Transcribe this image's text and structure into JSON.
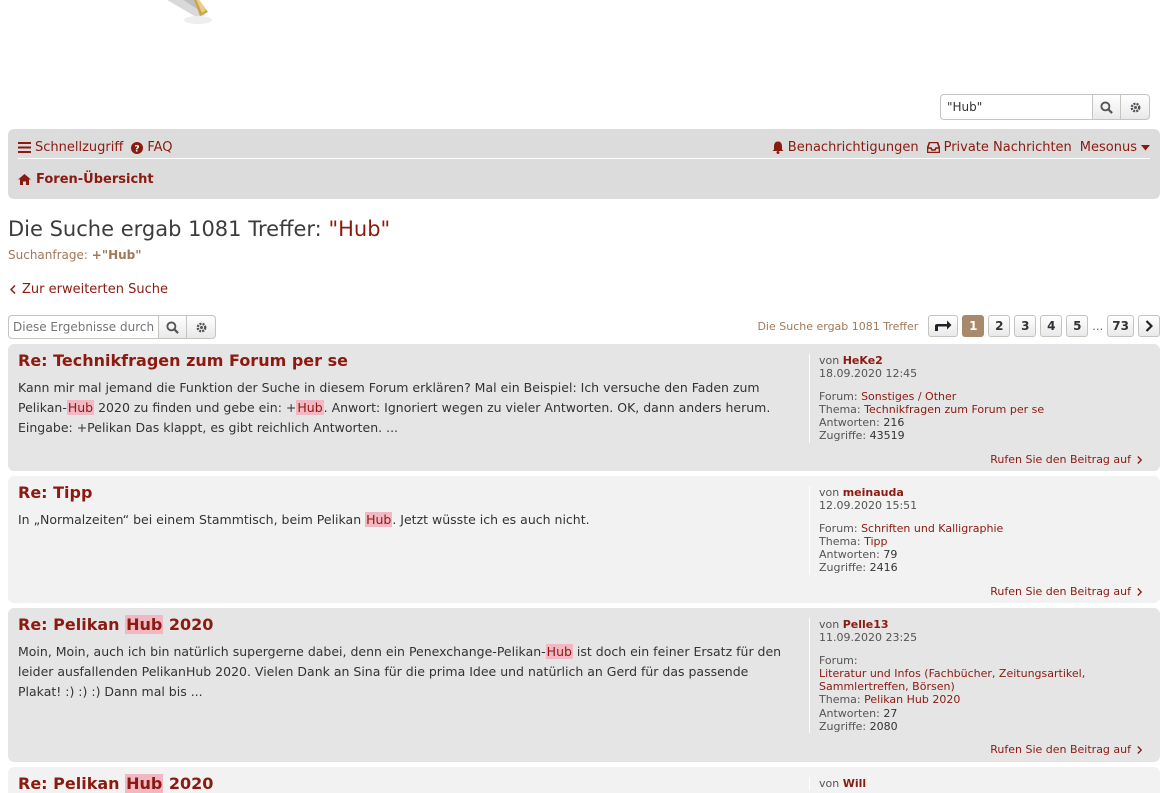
{
  "header": {
    "search_value": "\"Hub\""
  },
  "navbar": {
    "quicklinks": "Schnellzugriff",
    "faq": "FAQ",
    "notifications": "Benachrichtigungen",
    "private_messages": "Private Nachrichten",
    "username": "Mesonus",
    "breadcrumb": "Foren-Übersicht"
  },
  "search": {
    "title_prefix": "Die Suche ergab 1081 Treffer: ",
    "title_query": "\"Hub\"",
    "query_label": "Suchanfrage: ",
    "query_value": "+\"Hub\"",
    "advanced_link": "Zur erweiterten Suche",
    "filter_placeholder": "Diese Ergebnisse durchsuchen",
    "result_count": "Die Suche ergab 1081 Treffer"
  },
  "pagination": {
    "pages": [
      "1",
      "2",
      "3",
      "4",
      "5"
    ],
    "ellipsis": "…",
    "last": "73",
    "current": "1"
  },
  "labels": {
    "by": "von ",
    "forum": "Forum: ",
    "topic": "Thema: ",
    "replies": "Antworten: ",
    "views": "Zugriffe: ",
    "jump": "Rufen Sie den Beitrag auf"
  },
  "posts": [
    {
      "title": "Re: Technikfragen zum Forum per se",
      "body_parts": [
        "Kann mir mal jemand die Funktion der Suche in diesem Forum erklären? Mal ein Beispiel: Ich versuche den Faden zum Pelikan-",
        "Hub",
        " 2020 zu finden und gebe ein: +",
        "Hub",
        ". Anwort: Ignoriert wegen zu vieler Antworten. OK, dann anders herum. Eingabe: +Pelikan Das klappt, es gibt reichlich Antworten. ..."
      ],
      "author": "HeKe2",
      "date": "18.09.2020 12:45",
      "forum": "Sonstiges / Other",
      "topic": "Technikfragen zum Forum per se",
      "replies": "216",
      "views": "43519"
    },
    {
      "title": "Re: Tipp",
      "body_parts": [
        "In „Normalzeiten“ bei einem Stammtisch, beim Pelikan ",
        "Hub",
        ". Jetzt wüsste ich es auch nicht."
      ],
      "author": "meinauda",
      "date": "12.09.2020 15:51",
      "forum": "Schriften und Kalligraphie",
      "topic": "Tipp",
      "replies": "79",
      "views": "2416"
    },
    {
      "title_parts": [
        "Re: Pelikan ",
        "Hub",
        " 2020"
      ],
      "body_parts": [
        "Moin, Moin, auch ich bin natürlich supergerne dabei, denn ein Penexchange-Pelikan-",
        "Hub",
        " ist doch ein feiner Ersatz für den leider ausfallenden PelikanHub 2020. Vielen Dank an Sina für die prima Idee und natürlich an Gerd für das passende Plakat! :) :) :) Dann mal bis ..."
      ],
      "author": "Pelle13",
      "date": "11.09.2020 23:25",
      "forum_line1": "Literatur und Infos (Fachbücher, Zeitungsartikel,",
      "forum_line2": "Sammlertreffen, Börsen)",
      "topic": "Pelikan Hub 2020",
      "replies": "27",
      "views": "2080"
    },
    {
      "title_parts": [
        "Re: Pelikan ",
        "Hub",
        " 2020"
      ],
      "author": "Will"
    }
  ],
  "colors": {
    "accent": "#8b1a10",
    "highlight": "#f1b7c2",
    "navbar_bg": "#dcdcdc",
    "post_bg_dark": "#e5e5e5",
    "post_bg_light": "#f2f2f2",
    "active_page": "#a8896b"
  }
}
